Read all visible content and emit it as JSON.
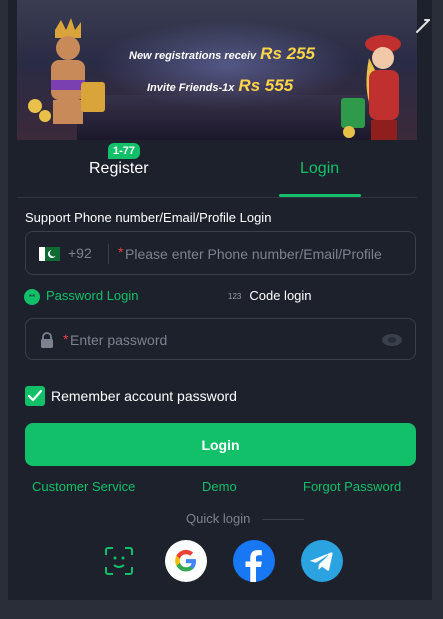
{
  "banner": {
    "line1_text": "New registrations receiv",
    "line1_amount": "Rs 255",
    "line2_text": "Invite Friends-1x",
    "line2_amount": "Rs 555"
  },
  "tabs": {
    "register_label": "Register",
    "register_badge": "1-77",
    "login_label": "Login",
    "active": "Login"
  },
  "form": {
    "support_label": "Support Phone number/Email/Profile Login",
    "country_code": "+92",
    "phone_placeholder": "Please enter Phone number/Email/Profile",
    "required_mark": "*",
    "password_placeholder": "Enter password",
    "mode_password_label": "Password Login",
    "mode_code_label": "Code login",
    "mode_code_icon_text": "123",
    "remember_label": "Remember account password",
    "remember_checked": true,
    "login_button": "Login"
  },
  "links": {
    "customer_service": "Customer Service",
    "demo": "Demo",
    "forgot_password": "Forgot Password"
  },
  "quick_login": {
    "label": "Quick login",
    "providers": [
      "face-id-icon",
      "google-icon",
      "facebook-icon",
      "telegram-icon"
    ]
  },
  "colors": {
    "accent": "#13c06a",
    "background": "#1d212b",
    "required": "#e3453a"
  }
}
